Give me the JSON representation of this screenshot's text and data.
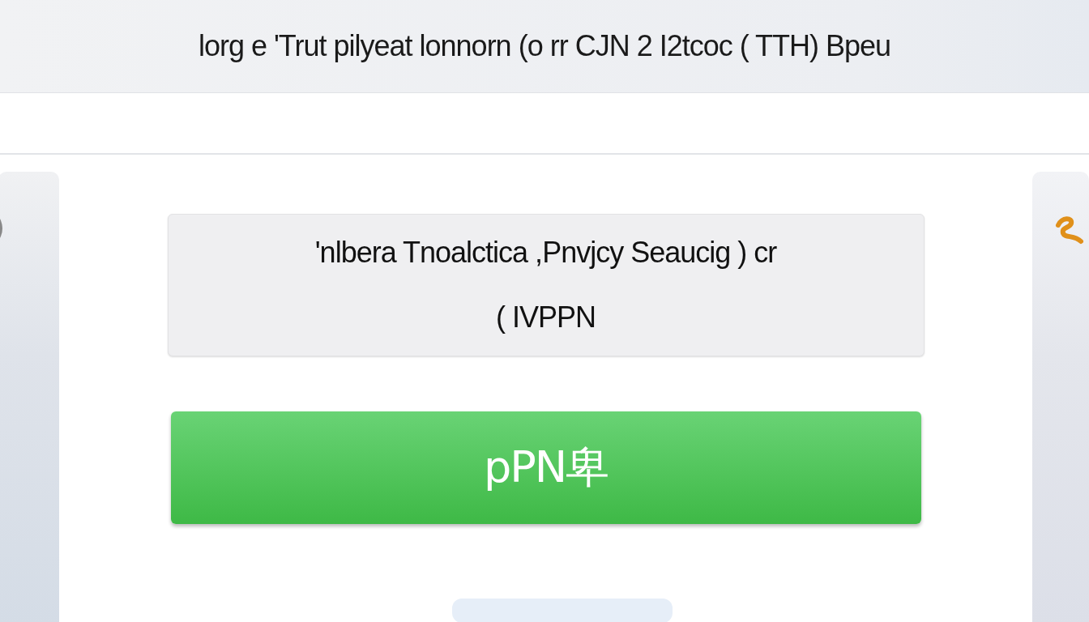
{
  "header": {
    "title": "lorg e 'Trut pilyeat lonnorn (o rr  CJN  2  I2tcoc (  TTH) Bpeu"
  },
  "card": {
    "lines": [
      "'nlbera Tnoalctica ,Pnvjcy  Seaucig ) cr",
      "(   IVPPN"
    ]
  },
  "primary_button": {
    "label": "pPN卑"
  }
}
